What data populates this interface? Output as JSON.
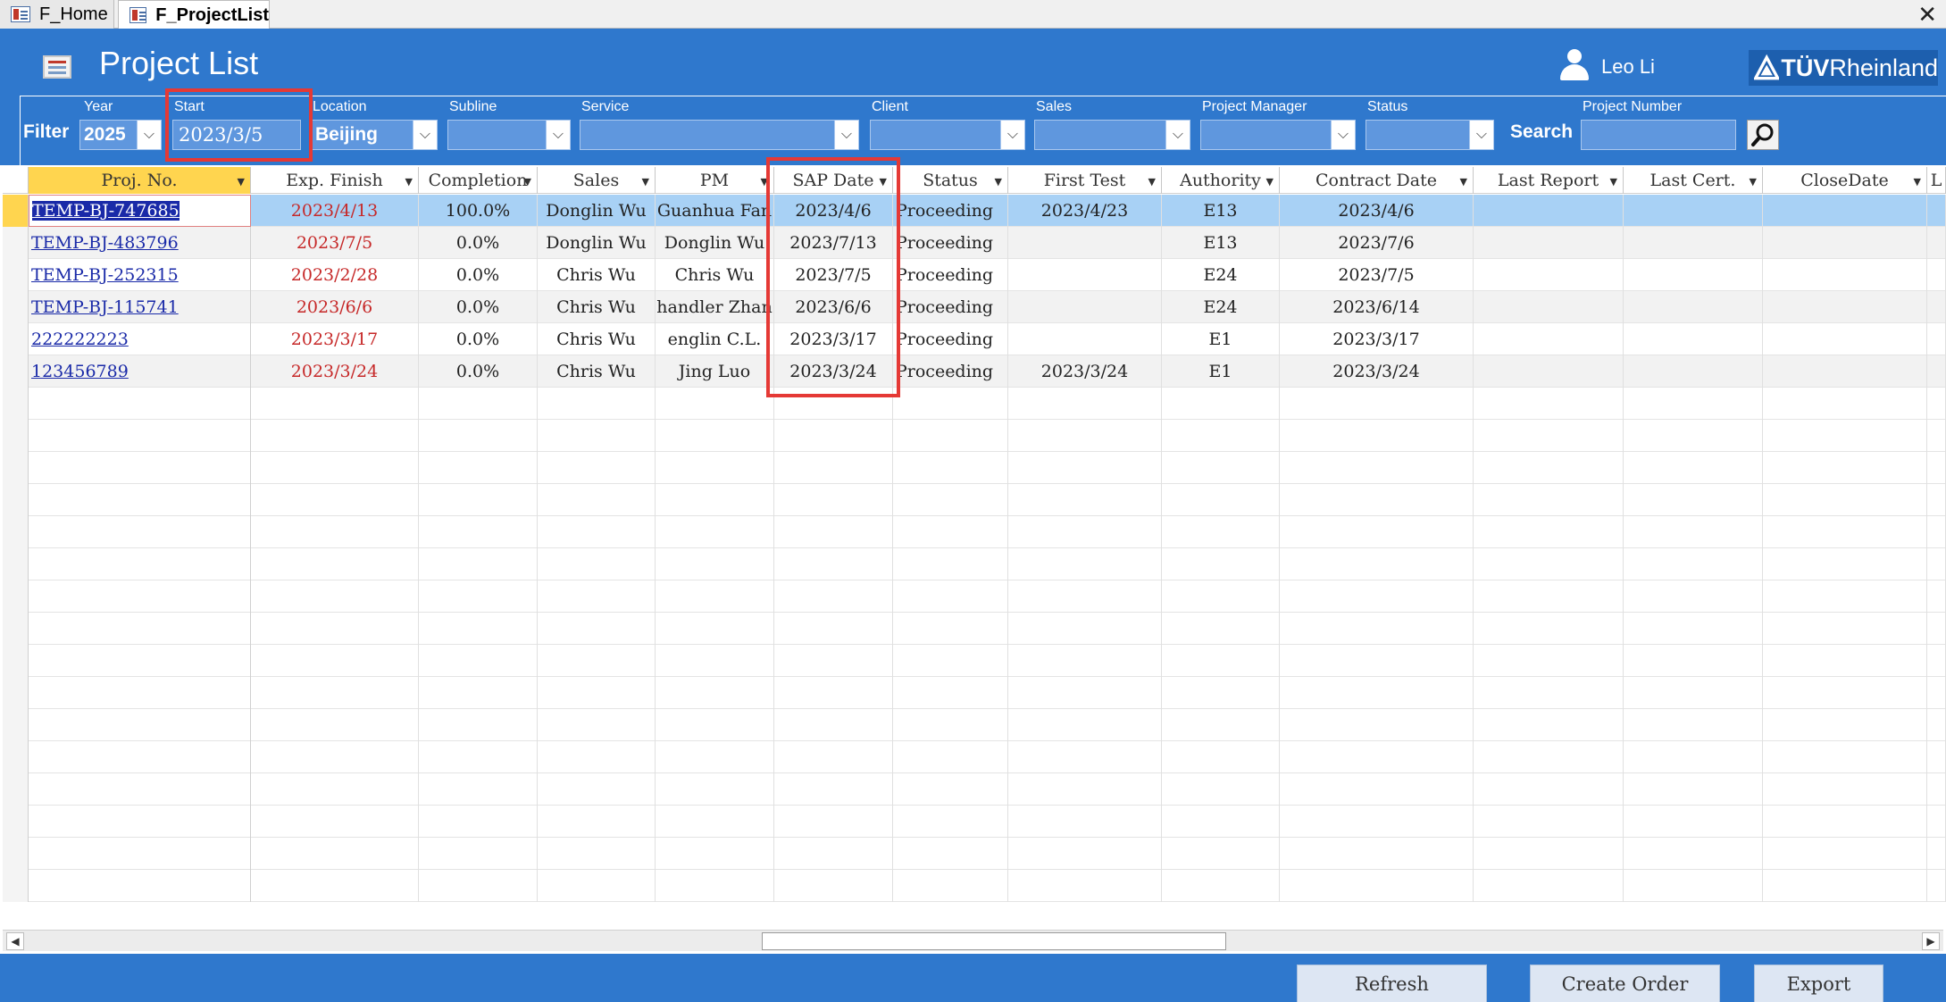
{
  "tabs": [
    {
      "label": "F_Home"
    },
    {
      "label": "F_ProjectList"
    }
  ],
  "header": {
    "title": "Project List",
    "user": "Leo Li",
    "logo_strong": "TÜV",
    "logo_rest": "Rheinland"
  },
  "filters": {
    "filter_label": "Filter",
    "search_label": "Search",
    "year": {
      "label": "Year",
      "value": "2025"
    },
    "start": {
      "label": "Start",
      "value": "2023/3/5"
    },
    "location": {
      "label": "Location",
      "value": "Beijing"
    },
    "subline": {
      "label": "Subline",
      "value": ""
    },
    "service": {
      "label": "Service",
      "value": ""
    },
    "client": {
      "label": "Client",
      "value": ""
    },
    "sales": {
      "label": "Sales",
      "value": ""
    },
    "project_manager": {
      "label": "Project Manager",
      "value": ""
    },
    "status": {
      "label": "Status",
      "value": ""
    },
    "project_number": {
      "label": "Project Number",
      "value": ""
    }
  },
  "grid": {
    "columns": [
      "Proj. No.",
      "Exp. Finish",
      "Completion",
      "Sales",
      "PM",
      "SAP Date",
      "Status",
      "First Test",
      "Authority",
      "Contract Date",
      "Last Report",
      "Last Cert.",
      "CloseDate",
      "L"
    ],
    "rows": [
      [
        "TEMP-BJ-747685",
        "2023/4/13",
        "100.0%",
        "Donglin Wu",
        "Guanhua Fan",
        "2023/4/6",
        "Proceeding",
        "2023/4/23",
        "E13",
        "2023/4/6",
        "",
        "",
        ""
      ],
      [
        "TEMP-BJ-483796",
        "2023/7/5",
        "0.0%",
        "Donglin Wu",
        "Donglin Wu",
        "2023/7/13",
        "Proceeding",
        "",
        "E13",
        "2023/7/6",
        "",
        "",
        ""
      ],
      [
        "TEMP-BJ-252315",
        "2023/2/28",
        "0.0%",
        "Chris Wu",
        "Chris Wu",
        "2023/7/5",
        "Proceeding",
        "",
        "E24",
        "2023/7/5",
        "",
        "",
        ""
      ],
      [
        "TEMP-BJ-115741",
        "2023/6/6",
        "0.0%",
        "Chris Wu",
        "handler Zhan",
        "2023/6/6",
        "Proceeding",
        "",
        "E24",
        "2023/6/14",
        "",
        "",
        ""
      ],
      [
        "222222223",
        "2023/3/17",
        "0.0%",
        "Chris Wu",
        "englin C.L.",
        "2023/3/17",
        "Proceeding",
        "",
        "E1",
        "2023/3/17",
        "",
        "",
        ""
      ],
      [
        "123456789",
        "2023/3/24",
        "0.0%",
        "Chris Wu",
        "Jing Luo",
        "2023/3/24",
        "Proceeding",
        "2023/3/24",
        "E1",
        "2023/3/24",
        "",
        "",
        ""
      ]
    ]
  },
  "footer": {
    "refresh": "Refresh",
    "create_order": "Create Order",
    "export": "Export"
  },
  "colors": {
    "header_bg": "#2f78cd",
    "highlight": "#e53935",
    "selected_row": "#a8d1f5",
    "header_active": "#ffd54f"
  }
}
